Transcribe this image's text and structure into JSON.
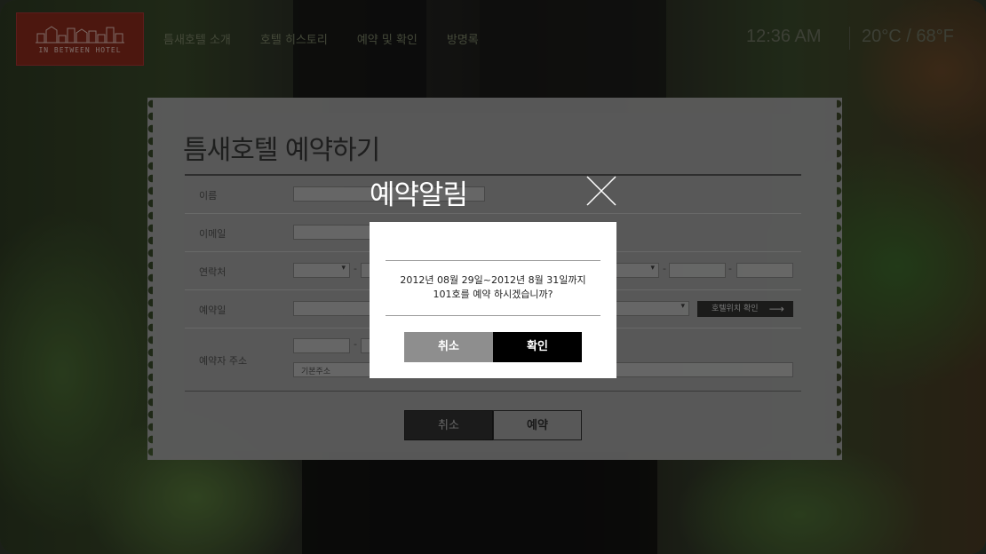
{
  "header": {
    "logo_text": "IN BETWEEN HOTEL",
    "nav": [
      "틈새호텔 소개",
      "호텔 히스토리",
      "예약 및 확인",
      "방명록"
    ],
    "clock": "12:36 AM",
    "weather": "20°C / 68°F"
  },
  "form": {
    "title": "틈새호텔 예약하기",
    "labels": {
      "name": "이름",
      "email": "이메일",
      "phone": "연락처",
      "date": "예약일",
      "address": "예약자 주소"
    },
    "location_button": "호텔위치 확인",
    "address_placeholder": "기본주소",
    "dash": "-",
    "cancel_button": "취소",
    "book_button": "예약"
  },
  "modal": {
    "title": "예약알림",
    "message_line1": "2012년 08월 29일~2012년 8월 31일까지",
    "message_line2": "101호를 예약 하시겠습니까?",
    "cancel_button": "취소",
    "confirm_button": "확인"
  },
  "colors": {
    "logo_bg": "#8b2a1d",
    "panel_bg": "#5b5b5b",
    "modal_bg": "#ffffff",
    "confirm_bg": "#000000",
    "cancel_bg": "#8e8e8e"
  }
}
